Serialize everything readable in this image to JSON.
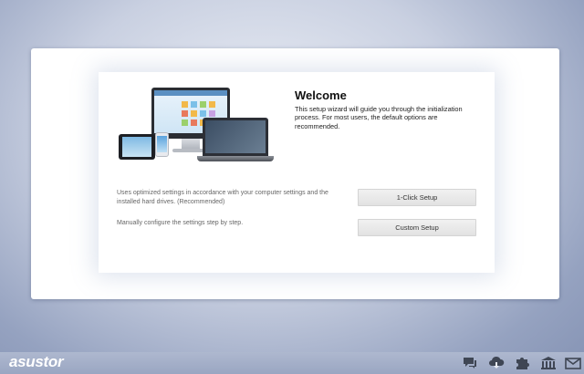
{
  "wizard": {
    "title": "Welcome",
    "description": "This setup wizard will guide you through the initialization process. For most users, the default options are recommended.",
    "options": [
      {
        "text": "Uses optimized settings in accordance with your computer settings and the installed hard drives. (Recommended)",
        "button": "1-Click Setup"
      },
      {
        "text": "Manually configure the settings step by step.",
        "button": "Custom Setup"
      }
    ]
  },
  "footer": {
    "logo": "asustor",
    "icons": [
      "chat-icon",
      "cloud-download-icon",
      "puzzle-icon",
      "bank-icon",
      "mail-icon"
    ]
  }
}
